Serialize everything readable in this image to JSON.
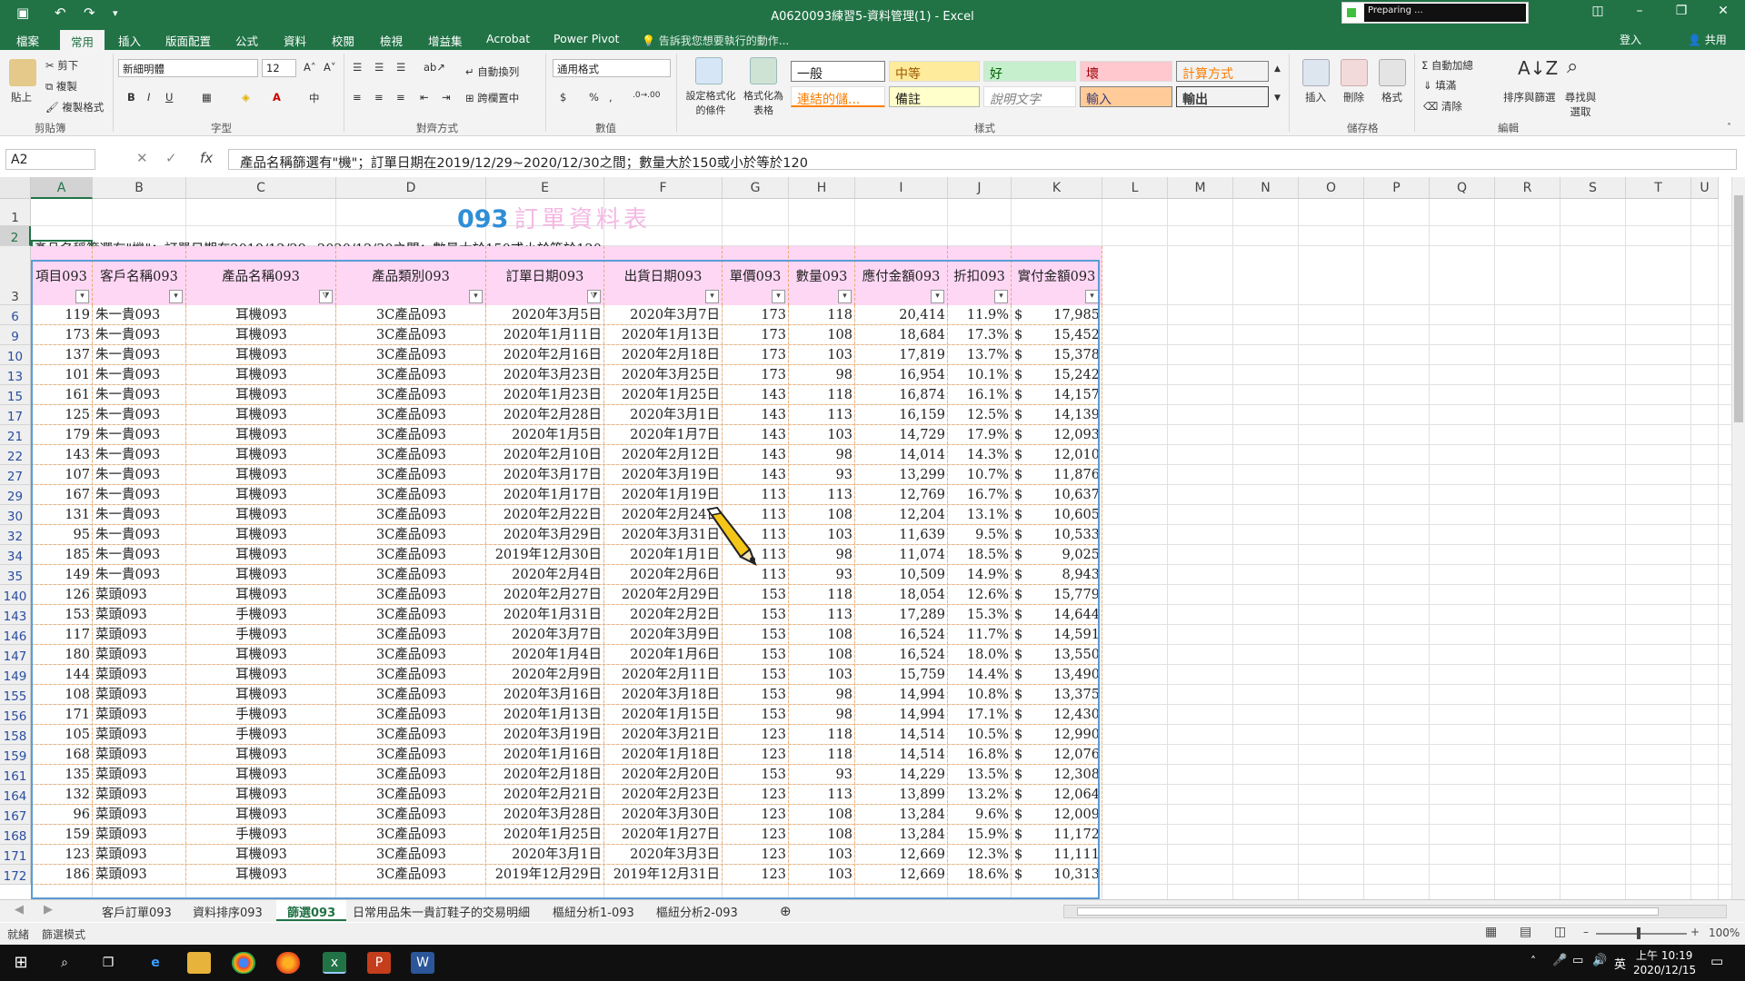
{
  "window": {
    "title": "A0620093練習5-資料管理(1) - Excel",
    "preparing": "Preparing ..."
  },
  "tabs": [
    "檔案",
    "常用",
    "插入",
    "版面配置",
    "公式",
    "資料",
    "校閱",
    "檢視",
    "增益集",
    "Acrobat",
    "Power Pivot"
  ],
  "active_tab": "常用",
  "tell_me": "告訴我您想要執行的動作...",
  "login": "登入",
  "share": "共用",
  "ribbon": {
    "clipboard": {
      "paste": "貼上",
      "cut": "剪下",
      "copy": "複製",
      "format_painter": "複製格式",
      "label": "剪貼簿"
    },
    "font": {
      "name": "新細明體",
      "size": "12",
      "label": "字型"
    },
    "align": {
      "wrap": "自動換列",
      "merge": "跨欄置中",
      "label": "對齊方式"
    },
    "number": {
      "format": "通用格式",
      "label": "數值"
    },
    "styles": {
      "conditional": "設定格式化的條件",
      "table": "格式化為表格",
      "label": "樣式",
      "cells": [
        "一般",
        "中等",
        "好",
        "壞",
        "計算方式",
        "連結的儲...",
        "備註",
        "說明文字",
        "輸入",
        "輸出"
      ]
    },
    "cells": {
      "insert": "插入",
      "delete": "刪除",
      "format": "格式",
      "label": "儲存格"
    },
    "editing": {
      "autosum": "自動加總",
      "fill": "填滿",
      "clear": "清除",
      "sort": "排序與篩選",
      "find": "尋找與選取",
      "label": "編輯"
    }
  },
  "formula_bar": {
    "namebox": "A2",
    "formula": "產品名稱篩選有\"機\"；訂單日期在2019/12/29~2020/12/30之間；數量大於150或小於等於120"
  },
  "columns": [
    "A",
    "B",
    "C",
    "D",
    "E",
    "F",
    "G",
    "H",
    "I",
    "J",
    "K",
    "L",
    "M",
    "N",
    "O",
    "P",
    "Q",
    "R",
    "S",
    "T",
    "U"
  ],
  "sheet": {
    "title_num": "093",
    "title_text": "訂單資料表",
    "row2_text": "產品名稱篩選有\"機\"；訂單日期在2019/12/29~2020/12/30之間；數量大於150或小於等於120",
    "headers": [
      "項目093",
      "客戶名稱093",
      "產品名稱093",
      "產品類別093",
      "訂單日期093",
      "出貨日期093",
      "單價093",
      "數量093",
      "應付金額093",
      "折扣093",
      "實付金額093"
    ],
    "filtered_cols": [
      2,
      4
    ],
    "rows": [
      {
        "r": "6",
        "d": [
          "119",
          "朱一貴093",
          "耳機093",
          "3C產品093",
          "2020年3月5日",
          "2020年3月7日",
          "173",
          "118",
          "20,414",
          "11.9%",
          "17,985"
        ]
      },
      {
        "r": "9",
        "d": [
          "173",
          "朱一貴093",
          "耳機093",
          "3C產品093",
          "2020年1月11日",
          "2020年1月13日",
          "173",
          "108",
          "18,684",
          "17.3%",
          "15,452"
        ]
      },
      {
        "r": "10",
        "d": [
          "137",
          "朱一貴093",
          "耳機093",
          "3C產品093",
          "2020年2月16日",
          "2020年2月18日",
          "173",
          "103",
          "17,819",
          "13.7%",
          "15,378"
        ]
      },
      {
        "r": "13",
        "d": [
          "101",
          "朱一貴093",
          "耳機093",
          "3C產品093",
          "2020年3月23日",
          "2020年3月25日",
          "173",
          "98",
          "16,954",
          "10.1%",
          "15,242"
        ]
      },
      {
        "r": "15",
        "d": [
          "161",
          "朱一貴093",
          "耳機093",
          "3C產品093",
          "2020年1月23日",
          "2020年1月25日",
          "143",
          "118",
          "16,874",
          "16.1%",
          "14,157"
        ]
      },
      {
        "r": "17",
        "d": [
          "125",
          "朱一貴093",
          "耳機093",
          "3C產品093",
          "2020年2月28日",
          "2020年3月1日",
          "143",
          "113",
          "16,159",
          "12.5%",
          "14,139"
        ]
      },
      {
        "r": "21",
        "d": [
          "179",
          "朱一貴093",
          "耳機093",
          "3C產品093",
          "2020年1月5日",
          "2020年1月7日",
          "143",
          "103",
          "14,729",
          "17.9%",
          "12,093"
        ]
      },
      {
        "r": "22",
        "d": [
          "143",
          "朱一貴093",
          "耳機093",
          "3C產品093",
          "2020年2月10日",
          "2020年2月12日",
          "143",
          "98",
          "14,014",
          "14.3%",
          "12,010"
        ]
      },
      {
        "r": "27",
        "d": [
          "107",
          "朱一貴093",
          "耳機093",
          "3C產品093",
          "2020年3月17日",
          "2020年3月19日",
          "143",
          "93",
          "13,299",
          "10.7%",
          "11,876"
        ]
      },
      {
        "r": "29",
        "d": [
          "167",
          "朱一貴093",
          "耳機093",
          "3C產品093",
          "2020年1月17日",
          "2020年1月19日",
          "113",
          "113",
          "12,769",
          "16.7%",
          "10,637"
        ]
      },
      {
        "r": "30",
        "d": [
          "131",
          "朱一貴093",
          "耳機093",
          "3C產品093",
          "2020年2月22日",
          "2020年2月24日",
          "113",
          "108",
          "12,204",
          "13.1%",
          "10,605"
        ]
      },
      {
        "r": "32",
        "d": [
          "95",
          "朱一貴093",
          "耳機093",
          "3C產品093",
          "2020年3月29日",
          "2020年3月31日",
          "113",
          "103",
          "11,639",
          "9.5%",
          "10,533"
        ]
      },
      {
        "r": "34",
        "d": [
          "185",
          "朱一貴093",
          "耳機093",
          "3C產品093",
          "2019年12月30日",
          "2020年1月1日",
          "113",
          "98",
          "11,074",
          "18.5%",
          "9,025"
        ]
      },
      {
        "r": "35",
        "d": [
          "149",
          "朱一貴093",
          "耳機093",
          "3C產品093",
          "2020年2月4日",
          "2020年2月6日",
          "113",
          "93",
          "10,509",
          "14.9%",
          "8,943"
        ]
      },
      {
        "r": "140",
        "d": [
          "126",
          "菜頭093",
          "耳機093",
          "3C產品093",
          "2020年2月27日",
          "2020年2月29日",
          "153",
          "118",
          "18,054",
          "12.6%",
          "15,779"
        ]
      },
      {
        "r": "143",
        "d": [
          "153",
          "菜頭093",
          "手機093",
          "3C產品093",
          "2020年1月31日",
          "2020年2月2日",
          "153",
          "113",
          "17,289",
          "15.3%",
          "14,644"
        ]
      },
      {
        "r": "146",
        "d": [
          "117",
          "菜頭093",
          "手機093",
          "3C產品093",
          "2020年3月7日",
          "2020年3月9日",
          "153",
          "108",
          "16,524",
          "11.7%",
          "14,591"
        ]
      },
      {
        "r": "147",
        "d": [
          "180",
          "菜頭093",
          "耳機093",
          "3C產品093",
          "2020年1月4日",
          "2020年1月6日",
          "153",
          "108",
          "16,524",
          "18.0%",
          "13,550"
        ]
      },
      {
        "r": "149",
        "d": [
          "144",
          "菜頭093",
          "耳機093",
          "3C產品093",
          "2020年2月9日",
          "2020年2月11日",
          "153",
          "103",
          "15,759",
          "14.4%",
          "13,490"
        ]
      },
      {
        "r": "155",
        "d": [
          "108",
          "菜頭093",
          "耳機093",
          "3C產品093",
          "2020年3月16日",
          "2020年3月18日",
          "153",
          "98",
          "14,994",
          "10.8%",
          "13,375"
        ]
      },
      {
        "r": "156",
        "d": [
          "171",
          "菜頭093",
          "手機093",
          "3C產品093",
          "2020年1月13日",
          "2020年1月15日",
          "153",
          "98",
          "14,994",
          "17.1%",
          "12,430"
        ]
      },
      {
        "r": "158",
        "d": [
          "105",
          "菜頭093",
          "手機093",
          "3C產品093",
          "2020年3月19日",
          "2020年3月21日",
          "123",
          "118",
          "14,514",
          "10.5%",
          "12,990"
        ]
      },
      {
        "r": "159",
        "d": [
          "168",
          "菜頭093",
          "耳機093",
          "3C產品093",
          "2020年1月16日",
          "2020年1月18日",
          "123",
          "118",
          "14,514",
          "16.8%",
          "12,076"
        ]
      },
      {
        "r": "161",
        "d": [
          "135",
          "菜頭093",
          "耳機093",
          "3C產品093",
          "2020年2月18日",
          "2020年2月20日",
          "153",
          "93",
          "14,229",
          "13.5%",
          "12,308"
        ]
      },
      {
        "r": "164",
        "d": [
          "132",
          "菜頭093",
          "耳機093",
          "3C產品093",
          "2020年2月21日",
          "2020年2月23日",
          "123",
          "113",
          "13,899",
          "13.2%",
          "12,064"
        ]
      },
      {
        "r": "167",
        "d": [
          "96",
          "菜頭093",
          "耳機093",
          "3C產品093",
          "2020年3月28日",
          "2020年3月30日",
          "123",
          "108",
          "13,284",
          "9.6%",
          "12,009"
        ]
      },
      {
        "r": "168",
        "d": [
          "159",
          "菜頭093",
          "手機093",
          "3C產品093",
          "2020年1月25日",
          "2020年1月27日",
          "123",
          "108",
          "13,284",
          "15.9%",
          "11,172"
        ]
      },
      {
        "r": "171",
        "d": [
          "123",
          "菜頭093",
          "耳機093",
          "3C產品093",
          "2020年3月1日",
          "2020年3月3日",
          "123",
          "103",
          "12,669",
          "12.3%",
          "11,111"
        ]
      },
      {
        "r": "172",
        "d": [
          "186",
          "菜頭093",
          "耳機093",
          "3C產品093",
          "2019年12月29日",
          "2019年12月31日",
          "123",
          "103",
          "12,669",
          "18.6%",
          "10,313"
        ]
      }
    ]
  },
  "sheet_tabs": [
    "客戶訂單093",
    "資料排序093",
    "篩選093",
    "日常用品朱一貴訂鞋子的交易明細",
    "樞紐分析1-093",
    "樞紐分析2-093"
  ],
  "active_sheet": "篩選093",
  "status": {
    "ready": "就緒",
    "filter_mode": "篩選模式",
    "zoom": "100%"
  },
  "clock": {
    "time": "上午 10:19",
    "date": "2020/12/15"
  },
  "tray": {
    "lang": "英"
  },
  "colors": {
    "excel_green": "#217346",
    "header_pink": "#fdd7f4",
    "title_blue": "#2e8ed6",
    "title_pink": "#f4b8e4"
  }
}
